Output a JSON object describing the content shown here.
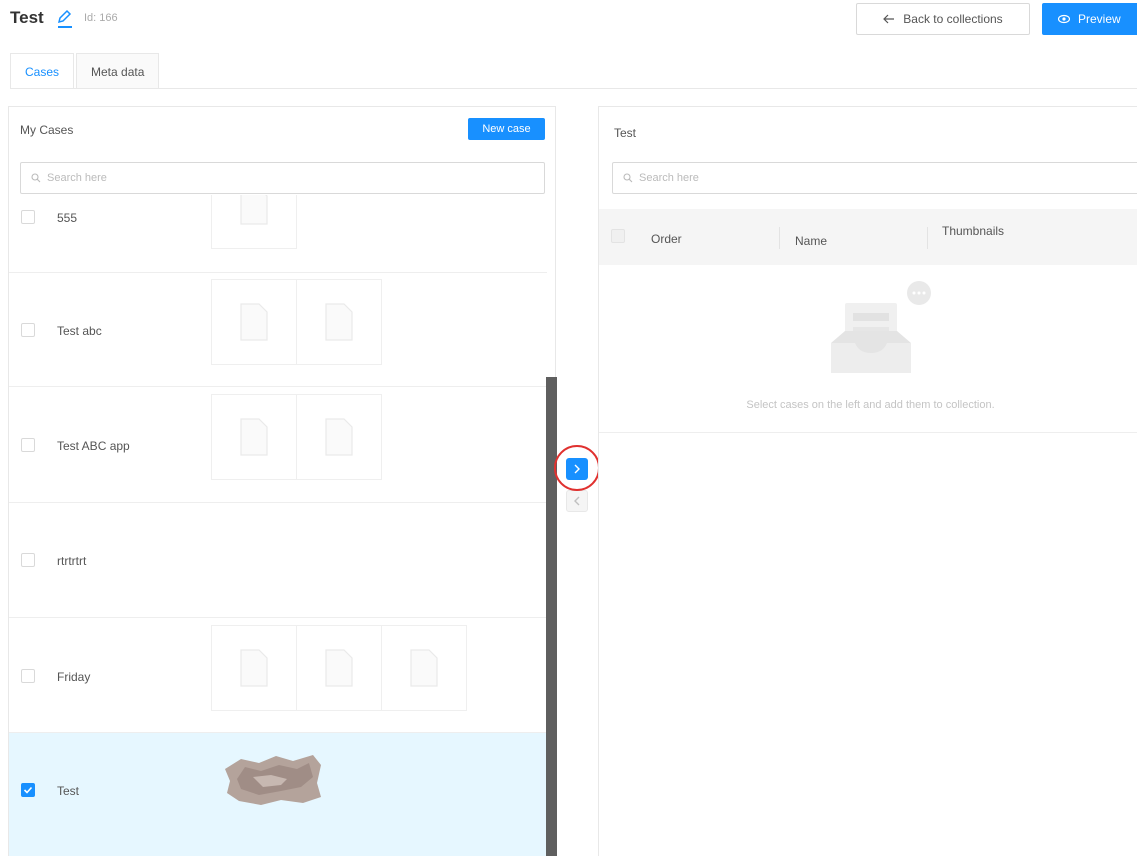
{
  "header": {
    "title": "Test",
    "id_text": "Id: 166",
    "back_label": "Back to collections",
    "preview_label": "Preview"
  },
  "tabs": [
    {
      "label": "Cases",
      "active": true
    },
    {
      "label": "Meta data",
      "active": false
    }
  ],
  "left_panel": {
    "title": "My Cases",
    "new_case_label": "New case",
    "search_placeholder": "Search here",
    "cases": [
      {
        "name": "555",
        "checked": false,
        "thumbnails": 1
      },
      {
        "name": "Test abc",
        "checked": false,
        "thumbnails": 2
      },
      {
        "name": "Test ABC app",
        "checked": false,
        "thumbnails": 2
      },
      {
        "name": "rtrtrtrt",
        "checked": false,
        "thumbnails": 0
      },
      {
        "name": "Friday",
        "checked": false,
        "thumbnails": 3
      },
      {
        "name": "Test",
        "checked": true,
        "thumbnails": 1,
        "thumbnail_kind": "photo"
      }
    ]
  },
  "right_panel": {
    "title": "Test",
    "search_placeholder": "Search here",
    "columns": [
      "Order",
      "Name",
      "Thumbnails"
    ],
    "empty_text": "Select cases on the left and add them to collection."
  },
  "transfer": {
    "right_symbol": ">",
    "left_symbol": "<"
  },
  "colors": {
    "accent": "#1890ff",
    "selected_row": "#e6f7ff",
    "highlight_circle": "#e0312f"
  }
}
